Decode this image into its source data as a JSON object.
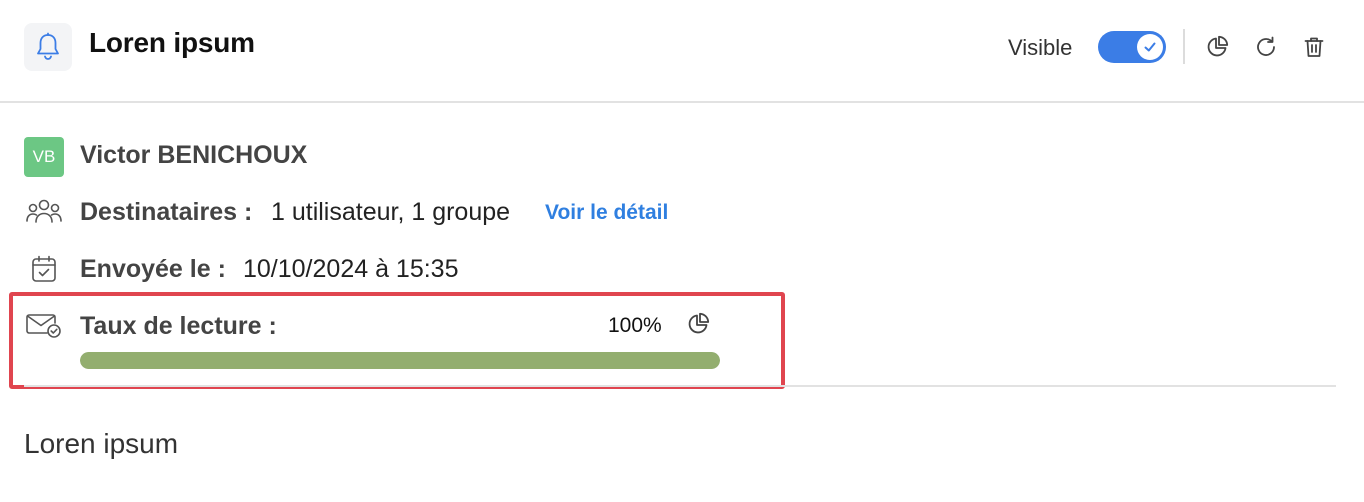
{
  "header": {
    "title": "Loren ipsum",
    "visible_label": "Visible",
    "toggle_on": true,
    "icons": [
      "bell-icon",
      "pie-chart-icon",
      "refresh-icon",
      "trash-icon"
    ]
  },
  "author": {
    "initials": "VB",
    "name": "Victor BENICHOUX",
    "avatar_color": "#6cc784"
  },
  "recipients": {
    "label": "Destinataires :",
    "value": "1 utilisateur, 1 groupe",
    "link": "Voir le détail"
  },
  "sent": {
    "label": "Envoyée le :",
    "value": "10/10/2024 à 15:35"
  },
  "read_rate": {
    "label": "Taux de lecture :",
    "percent_text": "100%",
    "progress": 1.0
  },
  "body": {
    "text": "Loren ipsum"
  },
  "colors": {
    "accent": "#3b7de6",
    "progress": "#93ae6f",
    "highlight": "#e0454f"
  }
}
